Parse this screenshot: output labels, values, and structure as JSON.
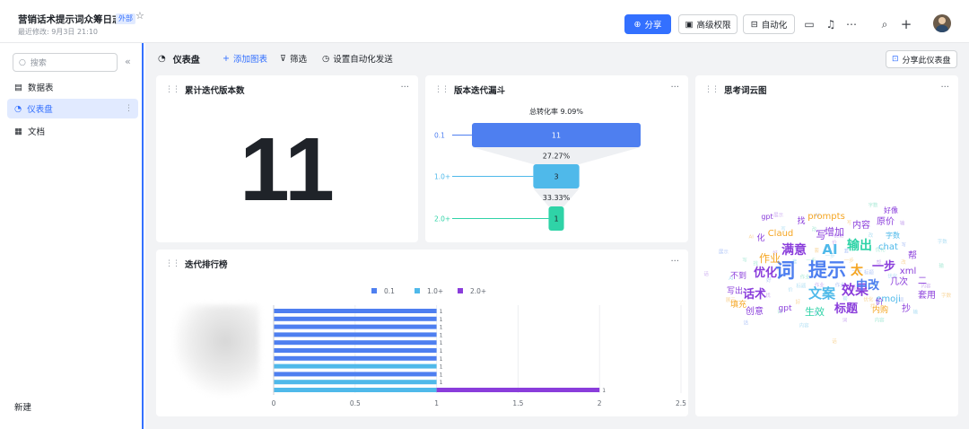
{
  "header": {
    "title": "营销话术提示词众筹日志",
    "badge": "外部",
    "subtitle": "最近修改: 9月3日 21:10",
    "share": "分享",
    "permissions": "高级权限",
    "automation": "自动化"
  },
  "sidebar": {
    "search_placeholder": "搜索",
    "items": [
      {
        "label": "数据表",
        "icon": "table-icon"
      },
      {
        "label": "仪表盘",
        "icon": "dashboard-icon"
      },
      {
        "label": "文档",
        "icon": "document-icon"
      }
    ],
    "new_label": "新建"
  },
  "toolbar": {
    "title": "仪表盘",
    "add_chart": "添加图表",
    "filter": "筛选",
    "auto_send": "设置自动化发送",
    "share_dashboard": "分享此仪表盘"
  },
  "cards": {
    "total": {
      "title": "累计迭代版本数",
      "value": "11"
    },
    "funnel": {
      "title": "版本迭代漏斗"
    },
    "wordcloud": {
      "title": "思考词云图"
    },
    "ranking": {
      "title": "迭代排行榜"
    }
  },
  "chart_data": [
    {
      "type": "funnel",
      "title": "总转化率 9.09%",
      "stages": [
        {
          "label": "0.1",
          "value": 11,
          "color": "#4e7ff0"
        },
        {
          "label": "1.0+",
          "value": 3,
          "color": "#4fb9ea"
        },
        {
          "label": "2.0+",
          "value": 1,
          "color": "#2fd3a7"
        }
      ],
      "conversions": [
        "27.27%",
        "33.33%"
      ]
    },
    {
      "type": "bar",
      "orientation": "horizontal",
      "legend": [
        {
          "name": "0.1",
          "color": "#4e7ff0"
        },
        {
          "name": "1.0+",
          "color": "#4fb9ea"
        },
        {
          "name": "2.0+",
          "color": "#8a3ddb"
        }
      ],
      "bars": [
        {
          "series": "0.1",
          "value": 1
        },
        {
          "series": "0.1",
          "value": 1
        },
        {
          "series": "0.1",
          "value": 1
        },
        {
          "series": "0.1",
          "value": 1
        },
        {
          "series": "0.1",
          "value": 1
        },
        {
          "series": "0.1",
          "value": 1
        },
        {
          "series": "0.1",
          "value": 1
        },
        {
          "series": "1.0+",
          "value": 1
        },
        {
          "series": "0.1",
          "value": 1
        },
        {
          "series": "1.0+",
          "value": 1
        },
        {
          "series": "1.0++2.0+",
          "value": 2
        }
      ],
      "xticks": [
        "0",
        "0.5",
        "1",
        "1.5",
        "2",
        "2.5"
      ],
      "xlim": [
        0,
        2.5
      ]
    }
  ],
  "wordcloud": {
    "words": [
      {
        "t": "词",
        "c": "#4e7ff0",
        "s": 22
      },
      {
        "t": "提示",
        "c": "#4e7ff0",
        "s": 21
      },
      {
        "t": "AI",
        "c": "#4fb9ea",
        "s": 15
      },
      {
        "t": "文案",
        "c": "#4fb9ea",
        "s": 15
      },
      {
        "t": "效果",
        "c": "#8a3ddb",
        "s": 15
      },
      {
        "t": "满意",
        "c": "#8a3ddb",
        "s": 14
      },
      {
        "t": "输出",
        "c": "#2fd3a7",
        "s": 14
      },
      {
        "t": "优化",
        "c": "#8a3ddb",
        "s": 13
      },
      {
        "t": "中改",
        "c": "#4e7ff0",
        "s": 13
      },
      {
        "t": "太",
        "c": "#f5a623",
        "s": 14
      },
      {
        "t": "一步",
        "c": "#8a3ddb",
        "s": 13
      },
      {
        "t": "话术",
        "c": "#8a3ddb",
        "s": 13
      },
      {
        "t": "标题",
        "c": "#8a3ddb",
        "s": 13
      },
      {
        "t": "作业",
        "c": "#f5a623",
        "s": 12
      },
      {
        "t": "增加",
        "c": "#8a3ddb",
        "s": 11
      },
      {
        "t": "写",
        "c": "#8a3ddb",
        "s": 12
      },
      {
        "t": "prompts",
        "c": "#f5a623",
        "s": 10
      },
      {
        "t": "Claud",
        "c": "#f5a623",
        "s": 10
      },
      {
        "t": "内容",
        "c": "#8a3ddb",
        "s": 10
      },
      {
        "t": "原价",
        "c": "#8a3ddb",
        "s": 10
      },
      {
        "t": "chat",
        "c": "#4fb9ea",
        "s": 10
      },
      {
        "t": "xml",
        "c": "#8a3ddb",
        "s": 10
      },
      {
        "t": "几次",
        "c": "#8a3ddb",
        "s": 10
      },
      {
        "t": "emoji",
        "c": "#4fb9ea",
        "s": 10
      },
      {
        "t": "套用",
        "c": "#8a3ddb",
        "s": 10
      },
      {
        "t": "生效",
        "c": "#2fd3a7",
        "s": 11
      },
      {
        "t": "创意",
        "c": "#8a3ddb",
        "s": 10
      },
      {
        "t": "不到",
        "c": "#8a3ddb",
        "s": 9
      },
      {
        "t": "写出",
        "c": "#8a3ddb",
        "s": 9
      },
      {
        "t": "填充",
        "c": "#f5a623",
        "s": 9
      },
      {
        "t": "gpt",
        "c": "#8a3ddb",
        "s": 9
      },
      {
        "t": "抄",
        "c": "#8a3ddb",
        "s": 10
      },
      {
        "t": "帮",
        "c": "#8a3ddb",
        "s": 10
      },
      {
        "t": "二",
        "c": "#8a3ddb",
        "s": 10
      },
      {
        "t": "好像",
        "c": "#8a3ddb",
        "s": 8
      },
      {
        "t": "字数",
        "c": "#4fb9ea",
        "s": 8
      },
      {
        "t": "内购",
        "c": "#f5a623",
        "s": 9
      },
      {
        "t": "价",
        "c": "#8a3ddb",
        "s": 9
      },
      {
        "t": "找",
        "c": "#8a3ddb",
        "s": 9
      },
      {
        "t": "化",
        "c": "#8a3ddb",
        "s": 9
      },
      {
        "t": "gpt",
        "c": "#8a3ddb",
        "s": 8
      }
    ]
  }
}
